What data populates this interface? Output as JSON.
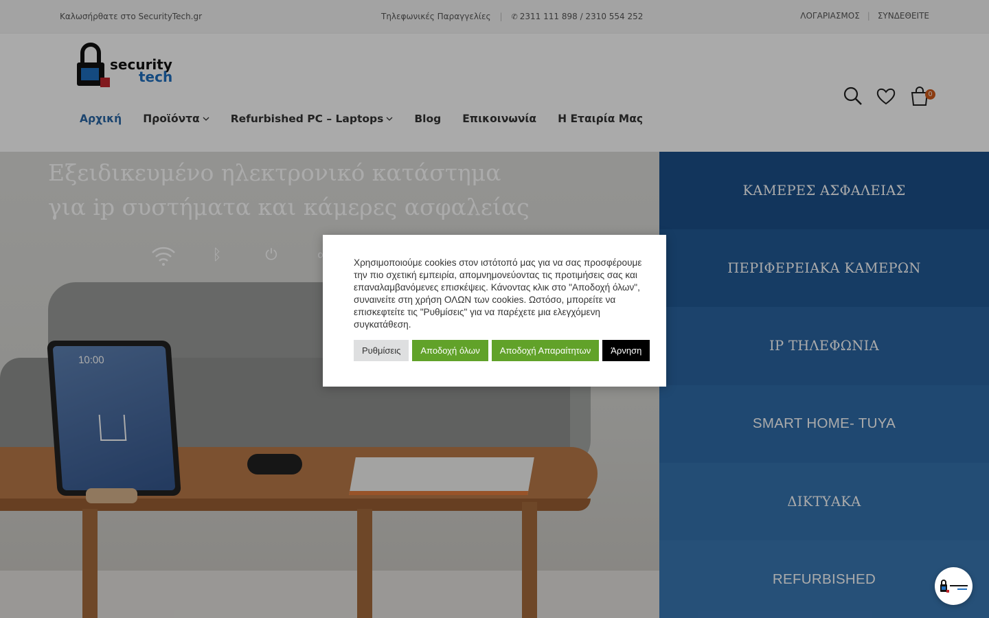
{
  "topbar": {
    "welcome": "Καλωσήρθατε στο SecurityTech.gr",
    "phone_label": "Τηλεφωνικές Παραγγελίες",
    "phones": "2311 111 898 / 2310 554 252",
    "account": "ΛΟΓΑΡΙΑΣΜΟΣ",
    "login": "ΣΥΝΔΕΘΕΙΤΕ"
  },
  "logo": {
    "line1": "security",
    "line2": "tech"
  },
  "nav": [
    {
      "label": "Αρχική",
      "active": true,
      "dropdown": false
    },
    {
      "label": "Προϊόντα",
      "active": false,
      "dropdown": true
    },
    {
      "label": "Refurbished PC – Laptops",
      "active": false,
      "dropdown": true
    },
    {
      "label": "Blog",
      "active": false,
      "dropdown": false
    },
    {
      "label": "Επικοινωνία",
      "active": false,
      "dropdown": false
    },
    {
      "label": "Η Εταιρία Μας",
      "active": false,
      "dropdown": false
    }
  ],
  "header_icons": {
    "search": "search-icon",
    "wishlist": "heart-icon",
    "cart": "cart-icon",
    "cart_count": "0"
  },
  "hero": {
    "line1": "Εξειδικευμένο ηλεκτρονικό κατάστημα",
    "line2": "για ip συστήματα και κάμερες ασφαλείας",
    "tablet_time": "10:00"
  },
  "categories": [
    {
      "label": "ΚΑΜΕΡΕΣ ΑΣΦΑΛΕΙΑΣ",
      "color": "#1b4f8a",
      "font": "serif"
    },
    {
      "label": "ΠΕΡΙΦΕΡΕΙΑΚΑ ΚΑΜΕΡΩΝ",
      "color": "#225a96",
      "font": "serif"
    },
    {
      "label": "IP ΤΗΛΕΦΩΝΙΑ",
      "color": "#2a65a2",
      "font": "serif"
    },
    {
      "label": "SMART HOME- TUYA",
      "color": "#2f6ca9",
      "font": "sans"
    },
    {
      "label": "ΔΙΚΤΥΑΚΑ",
      "color": "#3573af",
      "font": "serif"
    },
    {
      "label": "REFURBISHED",
      "color": "#3a78b4",
      "font": "sans"
    }
  ],
  "cookie": {
    "text": "Χρησιμοποιούμε cookies στον ιστότοπό μας για να σας προσφέρουμε την πιο σχετική εμπειρία, απομνημονεύοντας τις προτιμήσεις σας και επαναλαμβανόμενες επισκέψεις. Κάνοντας κλικ στο \"Αποδοχή όλων\", συναινείτε στη χρήση ΟΛΩΝ των cookies. Ωστόσο, μπορείτε να επισκεφτείτε τις \"Ρυθμίσεις\" για να παρέχετε μια ελεγχόμενη συγκατάθεση.",
    "settings": "Ρυθμίσεις",
    "accept_all": "Αποδοχή όλων",
    "accept_necessary": "Αποδοχή Απαραίτητων",
    "reject": "Άρνηση",
    "accept_color": "#61a229"
  },
  "chat": {
    "icon": "chat-logo-icon"
  }
}
